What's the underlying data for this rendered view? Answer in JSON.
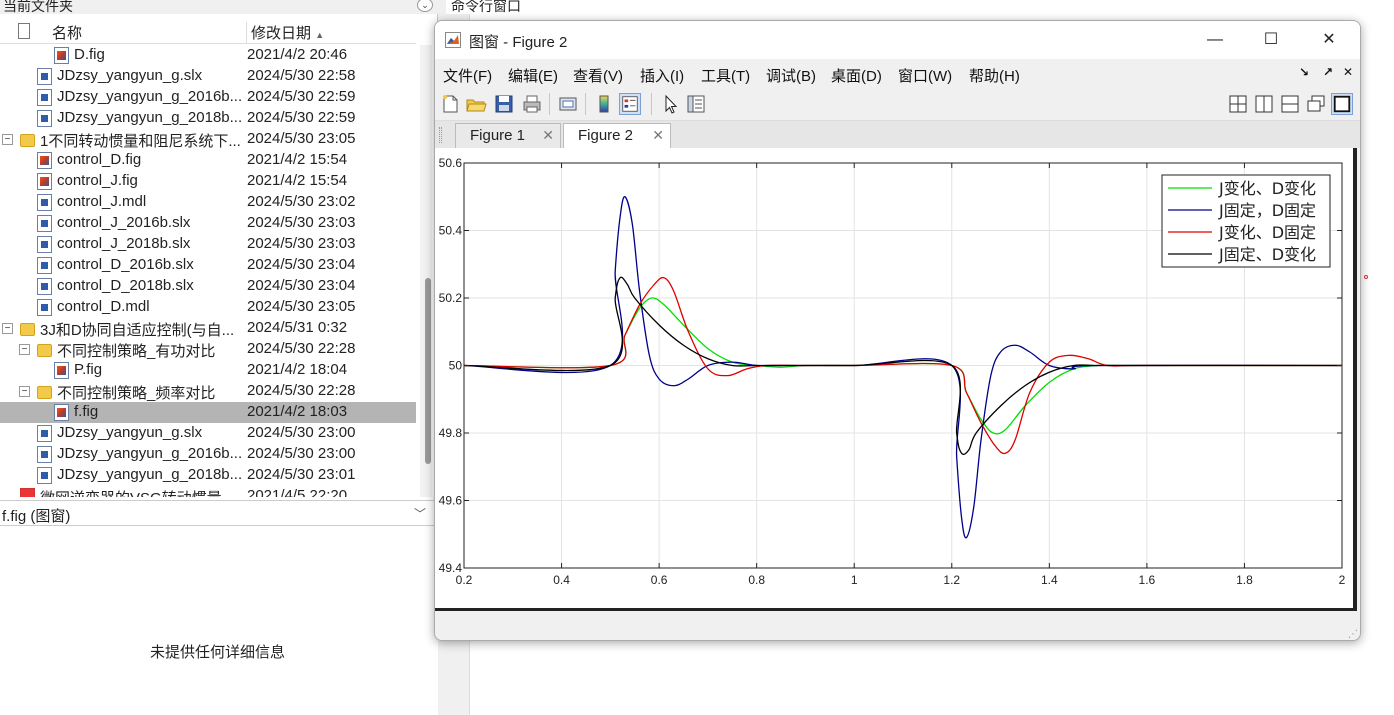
{
  "left_panel": {
    "title": "当前文件夹",
    "header": {
      "name": "名称",
      "date": "修改日期",
      "sort_arrow": "▲"
    },
    "rows": [
      {
        "name": "D.fig",
        "date": "2021/4/2 20:46",
        "icon": "fig-file-icon",
        "indent": 2,
        "toggle": ""
      },
      {
        "name": "JDzsy_yangyun_g.slx",
        "date": "2024/5/30 22:58",
        "icon": "simulink-file-icon",
        "indent": 1,
        "toggle": ""
      },
      {
        "name": "JDzsy_yangyun_g_2016b...",
        "date": "2024/5/30 22:59",
        "icon": "simulink-file-icon",
        "indent": 1,
        "toggle": ""
      },
      {
        "name": "JDzsy_yangyun_g_2018b...",
        "date": "2024/5/30 22:59",
        "icon": "simulink-file-icon",
        "indent": 1,
        "toggle": ""
      },
      {
        "name": "1不同转动惯量和阻尼系统下...",
        "date": "2024/5/30 23:05",
        "icon": "folder-icon",
        "indent": 0,
        "toggle": "−"
      },
      {
        "name": "control_D.fig",
        "date": "2021/4/2 15:54",
        "icon": "fig-file-icon",
        "indent": 1,
        "toggle": ""
      },
      {
        "name": "control_J.fig",
        "date": "2021/4/2 15:54",
        "icon": "fig-file-icon",
        "indent": 1,
        "toggle": ""
      },
      {
        "name": "control_J.mdl",
        "date": "2024/5/30 23:02",
        "icon": "simulink-file-icon",
        "indent": 1,
        "toggle": ""
      },
      {
        "name": "control_J_2016b.slx",
        "date": "2024/5/30 23:03",
        "icon": "simulink-file-icon",
        "indent": 1,
        "toggle": ""
      },
      {
        "name": "control_J_2018b.slx",
        "date": "2024/5/30 23:03",
        "icon": "simulink-file-icon",
        "indent": 1,
        "toggle": ""
      },
      {
        "name": "control_D_2016b.slx",
        "date": "2024/5/30 23:04",
        "icon": "simulink-file-icon",
        "indent": 1,
        "toggle": ""
      },
      {
        "name": "control_D_2018b.slx",
        "date": "2024/5/30 23:04",
        "icon": "simulink-file-icon",
        "indent": 1,
        "toggle": ""
      },
      {
        "name": "control_D.mdl",
        "date": "2024/5/30 23:05",
        "icon": "simulink-file-icon",
        "indent": 1,
        "toggle": ""
      },
      {
        "name": "3J和D协同自适应控制(与自...",
        "date": "2024/5/31 0:32",
        "icon": "folder-icon",
        "indent": 0,
        "toggle": "−"
      },
      {
        "name": "不同控制策略_有功对比",
        "date": "2024/5/30 22:28",
        "icon": "folder-icon",
        "indent": 1,
        "toggle": "−"
      },
      {
        "name": "P.fig",
        "date": "2021/4/2 18:04",
        "icon": "fig-file-icon",
        "indent": 2,
        "toggle": ""
      },
      {
        "name": "不同控制策略_频率对比",
        "date": "2024/5/30 22:28",
        "icon": "folder-icon",
        "indent": 1,
        "toggle": "−"
      },
      {
        "name": "f.fig",
        "date": "2021/4/2 18:03",
        "icon": "fig-file-icon",
        "indent": 2,
        "toggle": "",
        "selected": true
      },
      {
        "name": "JDzsy_yangyun_g.slx",
        "date": "2024/5/30 23:00",
        "icon": "simulink-file-icon",
        "indent": 1,
        "toggle": ""
      },
      {
        "name": "JDzsy_yangyun_g_2016b...",
        "date": "2024/5/30 23:00",
        "icon": "simulink-file-icon",
        "indent": 1,
        "toggle": ""
      },
      {
        "name": "JDzsy_yangyun_g_2018b...",
        "date": "2024/5/30 23:01",
        "icon": "simulink-file-icon",
        "indent": 1,
        "toggle": ""
      },
      {
        "name": "微网逆变器的VSG转动惯量...",
        "date": "2021/4/5 22:20",
        "icon": "pdf-file-icon",
        "indent": 0,
        "toggle": ""
      }
    ],
    "detail_title": "f.fig  (图窗)",
    "detail_message": "未提供任何详细信息"
  },
  "command_window": {
    "title": "命令行窗口"
  },
  "figure_window": {
    "title": "图窗 - Figure 2",
    "menus": [
      "文件(F)",
      "编辑(E)",
      "查看(V)",
      "插入(I)",
      "工具(T)",
      "调试(B)",
      "桌面(D)",
      "窗口(W)",
      "帮助(H)"
    ],
    "tabs": [
      {
        "label": "Figure 1",
        "active": false
      },
      {
        "label": "Figure 2",
        "active": true
      }
    ],
    "close_glyph": "✕",
    "minimize_glyph": "—",
    "maximize_glyph": "☐"
  },
  "chart_data": {
    "type": "line",
    "title": "",
    "xlabel": "",
    "ylabel": "",
    "xlim": [
      0.2,
      2
    ],
    "ylim": [
      49.4,
      50.6
    ],
    "xticks": [
      "0.2",
      "0.4",
      "0.6",
      "0.8",
      "1",
      "1.2",
      "1.4",
      "1.6",
      "1.8",
      "2"
    ],
    "yticks": [
      "49.4",
      "49.6",
      "49.8",
      "50",
      "50.2",
      "50.4",
      "50.6"
    ],
    "grid": true,
    "legend_position": "top-right",
    "series": [
      {
        "name": "J变化、D变化",
        "color": "#00e000",
        "x": [
          0.2,
          0.5,
          0.53,
          0.56,
          0.585,
          0.61,
          0.65,
          0.7,
          0.75,
          0.8,
          0.85,
          0.9,
          1.0,
          1.2,
          1.23,
          1.26,
          1.285,
          1.31,
          1.35,
          1.4,
          1.45,
          1.5,
          1.55,
          1.6,
          2.0
        ],
        "y": [
          50,
          50,
          50.09,
          50.17,
          50.2,
          50.18,
          50.12,
          50.05,
          50.01,
          50.0,
          49.995,
          50.0,
          50,
          50,
          49.92,
          49.84,
          49.8,
          49.81,
          49.88,
          49.95,
          49.99,
          50.0,
          50.0,
          50,
          50
        ]
      },
      {
        "name": "J固定，D固定",
        "color": "#00008b",
        "x": [
          0.2,
          0.5,
          0.51,
          0.52,
          0.53,
          0.545,
          0.56,
          0.58,
          0.6,
          0.63,
          0.66,
          0.7,
          0.75,
          0.8,
          0.85,
          1.0,
          1.2,
          1.21,
          1.22,
          1.23,
          1.245,
          1.26,
          1.28,
          1.3,
          1.33,
          1.36,
          1.4,
          1.45,
          1.5,
          2.0
        ],
        "y": [
          50,
          50,
          50.28,
          50.44,
          50.5,
          50.42,
          50.22,
          50.03,
          49.96,
          49.94,
          49.96,
          50.0,
          50.01,
          50.0,
          50.0,
          50,
          50,
          49.73,
          49.55,
          49.49,
          49.58,
          49.78,
          49.97,
          50.04,
          50.06,
          50.04,
          50.0,
          49.99,
          50.0,
          50
        ]
      },
      {
        "name": "J变化、D固定",
        "color": "#e00000",
        "x": [
          0.2,
          0.5,
          0.53,
          0.56,
          0.59,
          0.61,
          0.63,
          0.66,
          0.7,
          0.74,
          0.78,
          0.82,
          0.9,
          1.0,
          1.2,
          1.23,
          1.26,
          1.29,
          1.31,
          1.33,
          1.36,
          1.4,
          1.44,
          1.48,
          1.52,
          1.6,
          2.0
        ],
        "y": [
          50,
          50,
          50.09,
          50.18,
          50.24,
          50.26,
          50.22,
          50.1,
          49.99,
          49.97,
          49.99,
          50.0,
          50.0,
          50,
          50,
          49.92,
          49.83,
          49.76,
          49.74,
          49.78,
          49.92,
          50.01,
          50.03,
          50.02,
          50.0,
          50.0,
          50
        ]
      },
      {
        "name": "J固定、D变化",
        "color": "#000000",
        "x": [
          0.2,
          0.5,
          0.51,
          0.52,
          0.535,
          0.55,
          0.6,
          0.65,
          0.7,
          0.75,
          0.8,
          0.85,
          1.0,
          1.2,
          1.21,
          1.22,
          1.235,
          1.25,
          1.3,
          1.35,
          1.4,
          1.45,
          1.5,
          1.55,
          2.0
        ],
        "y": [
          50,
          50,
          50.2,
          50.26,
          50.24,
          50.2,
          50.12,
          50.06,
          50.02,
          50.0,
          50.0,
          50,
          50,
          50,
          49.8,
          49.74,
          49.75,
          49.8,
          49.88,
          49.94,
          49.98,
          50.0,
          50.0,
          50,
          50
        ]
      }
    ]
  }
}
